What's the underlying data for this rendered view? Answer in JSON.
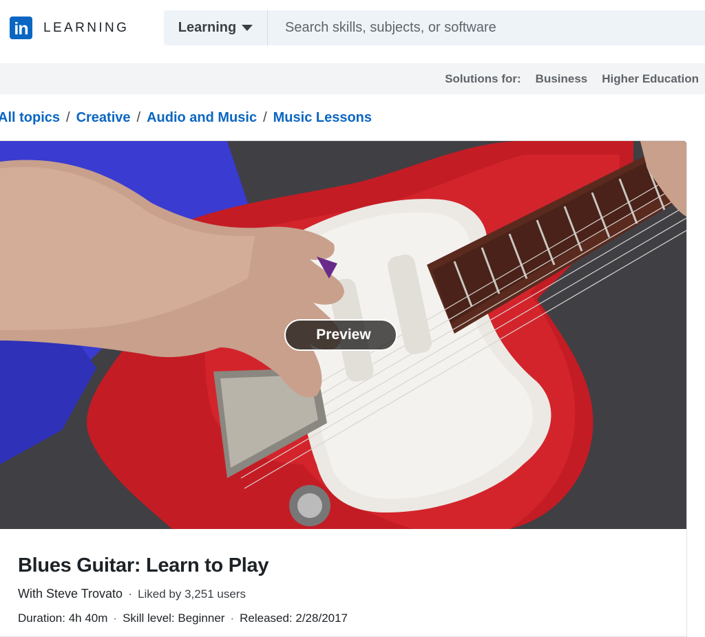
{
  "header": {
    "logo_mark": "in",
    "logo_text": "LEARNING",
    "search_scope": "Learning",
    "search_placeholder": "Search skills, subjects, or software"
  },
  "solutions": {
    "label": "Solutions for:",
    "links": [
      "Business",
      "Higher Education"
    ]
  },
  "breadcrumb": [
    "All topics",
    "Creative",
    "Audio and Music",
    "Music Lessons"
  ],
  "video": {
    "preview_label": "Preview"
  },
  "course": {
    "title": "Blues Guitar: Learn to Play",
    "instructor": "With Steve Trovato",
    "likes": "Liked by 3,251 users",
    "duration": "Duration: 4h 40m",
    "skill_level": "Skill level: Beginner",
    "released": "Released: 2/28/2017"
  },
  "colors": {
    "brand": "#0a66c2",
    "link": "#0a66c2"
  }
}
